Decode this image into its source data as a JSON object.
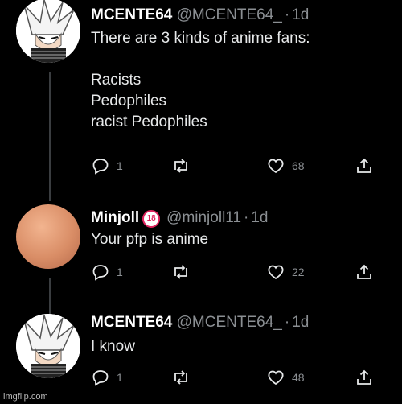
{
  "tweets": [
    {
      "name": "MCENTE64",
      "handle": "@MCENTE64_",
      "time": "1d",
      "text": "There are 3 kinds of anime fans:\n\nRacists\nPedophiles\nracist Pedophiles",
      "replies": "1",
      "retweets": "",
      "likes": "68",
      "avatar": "anime-character-avatar"
    },
    {
      "name": "Minjoll",
      "badge": "18",
      "handle": "@minjoll11",
      "time": "1d",
      "text": "Your pfp is anime",
      "replies": "1",
      "retweets": "",
      "likes": "22",
      "avatar": "orange-circle-avatar"
    },
    {
      "name": "MCENTE64",
      "handle": "@MCENTE64_",
      "time": "1d",
      "text": "I know",
      "replies": "1",
      "retweets": "",
      "likes": "48",
      "avatar": "anime-character-avatar"
    }
  ],
  "separator": "·",
  "watermark": "imgflip.com",
  "colors": {
    "background": "#000000",
    "text": "#e7e9ea",
    "muted": "#8b8f93",
    "thread_line": "#3a3d40"
  }
}
